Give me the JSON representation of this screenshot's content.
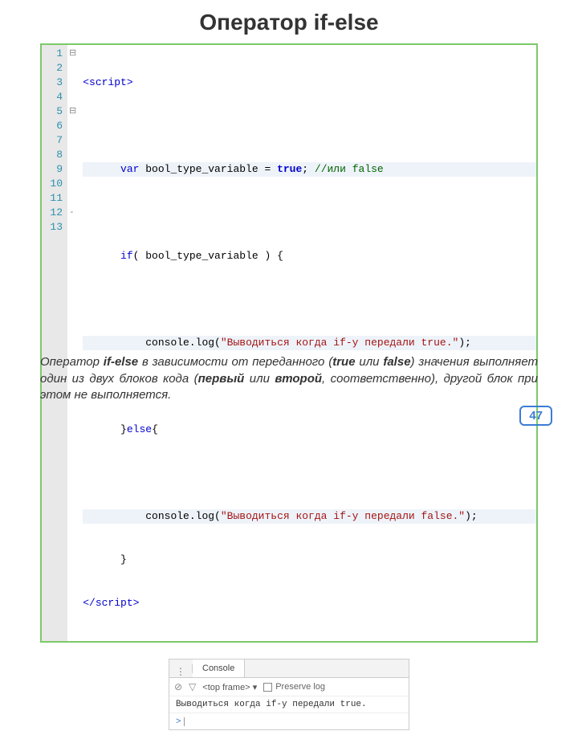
{
  "title": "Оператор if-else",
  "code": {
    "l1": "<script>",
    "l3_var": "var",
    "l3_name": " bool_type_variable = ",
    "l3_true": "true",
    "l3_semi": "; ",
    "l3_comment": "//или false",
    "l5_if": "if",
    "l5_rest": "( bool_type_variable ) {",
    "l7_a": "console.log(",
    "l7_str": "\"Выводиться когда if-y передали true.\"",
    "l7_b": ");",
    "l9_a": "}",
    "l9_else": "else",
    "l9_b": "{",
    "l11_a": "console.log(",
    "l11_str": "\"Выводиться когда if-y передали false.\"",
    "l11_b": ");",
    "l12": "}",
    "l13": "</script>"
  },
  "lines": [
    "1",
    "2",
    "3",
    "4",
    "5",
    "6",
    "7",
    "8",
    "9",
    "10",
    "11",
    "12",
    "13"
  ],
  "console": {
    "tab": "Console",
    "frame": "<top frame>",
    "caret": "▾",
    "preserve": "Preserve log",
    "output": "Выводиться когда if-y передали true.",
    "prompt": ">"
  },
  "desc": {
    "t1": "Оператор ",
    "b1": "if-else",
    "t2": " в зависимости от переданного (",
    "b2": "true",
    "t3": " или ",
    "b3": "false",
    "t4": ") значения выполняет один из двух блоков кода (",
    "b4": "первый",
    "t5": " или ",
    "b5": "второй",
    "t6": ", соответственно), другой блок при этом не выполняется."
  },
  "page": "47"
}
